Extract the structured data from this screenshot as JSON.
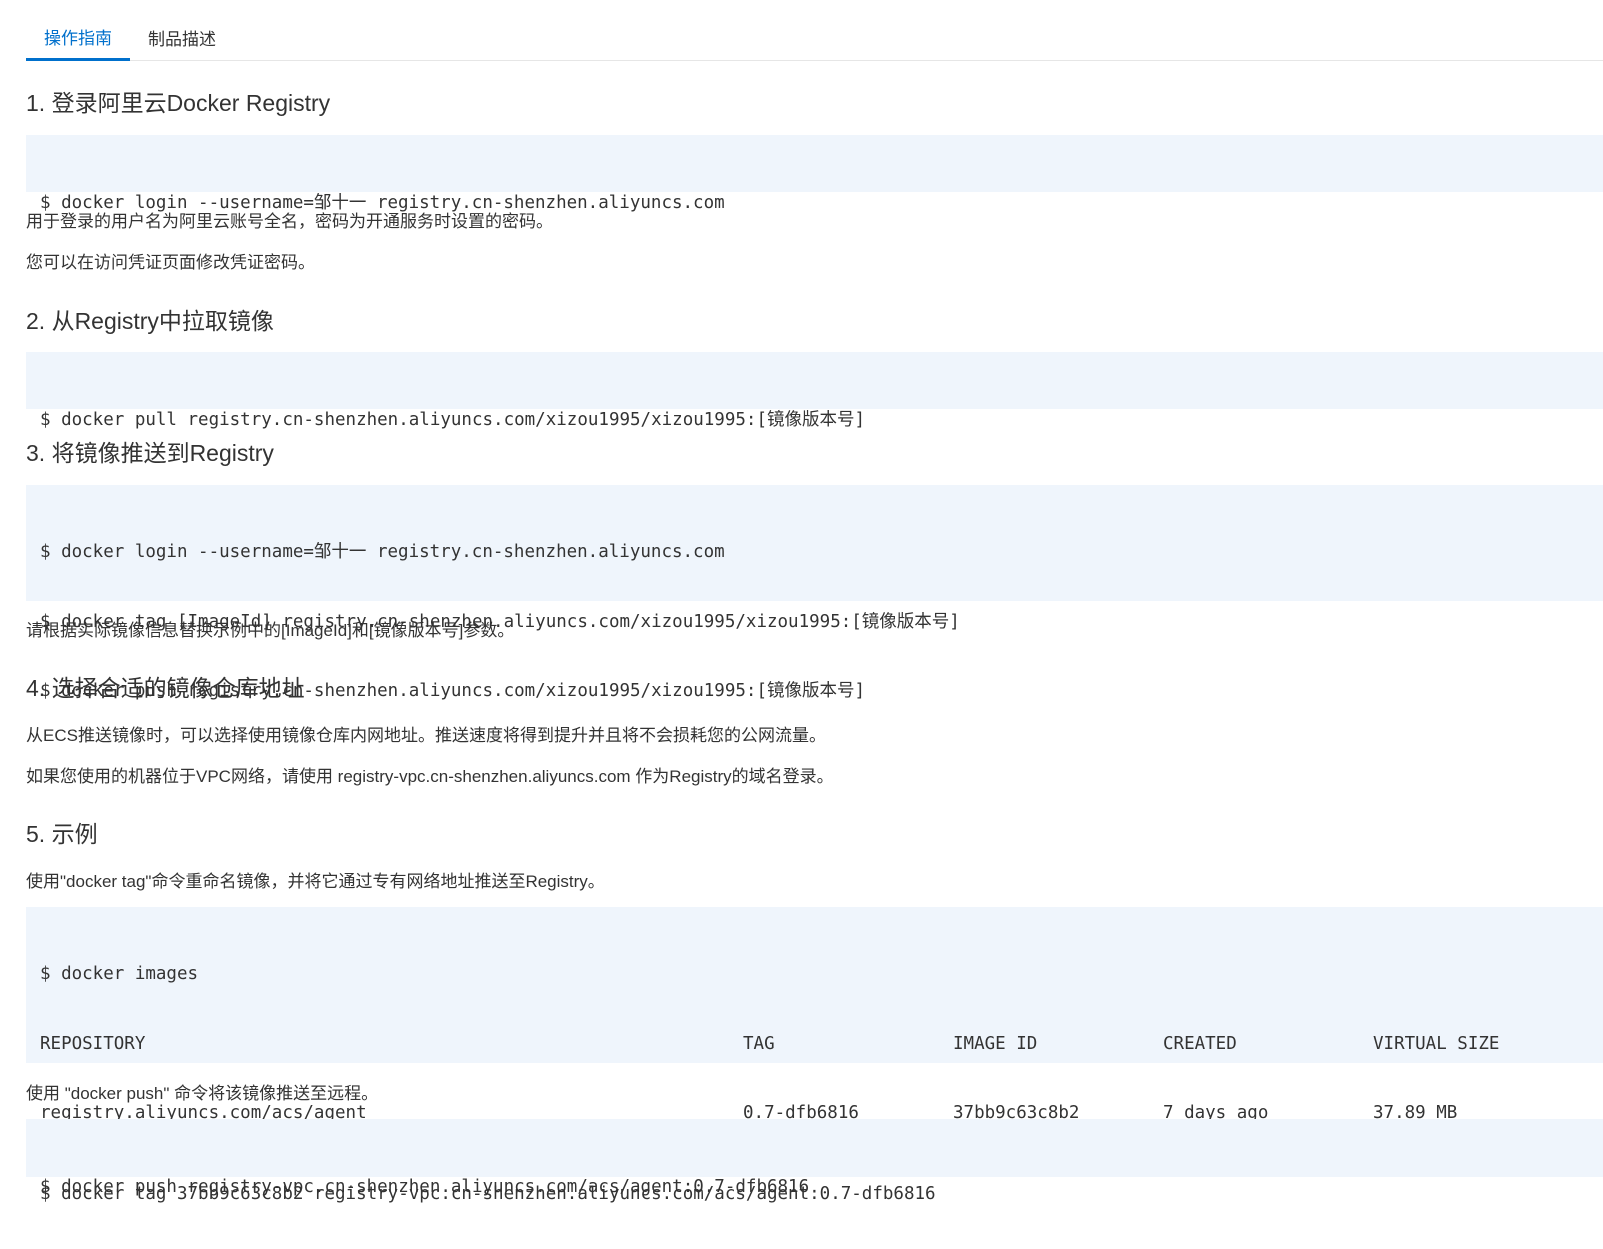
{
  "tabs": [
    {
      "label": "操作指南",
      "active": true
    },
    {
      "label": "制品描述",
      "active": false
    }
  ],
  "sections": {
    "s1": {
      "heading": "1. 登录阿里云Docker Registry",
      "code": [
        "$ docker login --username=邹十一 registry.cn-shenzhen.aliyuncs.com"
      ],
      "notes": [
        "用于登录的用户名为阿里云账号全名，密码为开通服务时设置的密码。",
        "您可以在访问凭证页面修改凭证密码。"
      ]
    },
    "s2": {
      "heading": "2. 从Registry中拉取镜像",
      "code": [
        "$ docker pull registry.cn-shenzhen.aliyuncs.com/xizou1995/xizou1995:[镜像版本号]"
      ]
    },
    "s3": {
      "heading": "3. 将镜像推送到Registry",
      "code": [
        "$ docker login --username=邹十一 registry.cn-shenzhen.aliyuncs.com",
        "$ docker tag [ImageId] registry.cn-shenzhen.aliyuncs.com/xizou1995/xizou1995:[镜像版本号]",
        "$ docker push registry.cn-shenzhen.aliyuncs.com/xizou1995/xizou1995:[镜像版本号]"
      ],
      "notes": [
        "请根据实际镜像信息替换示例中的[ImageId]和[镜像版本号]参数。"
      ]
    },
    "s4": {
      "heading": "4. 选择合适的镜像仓库地址",
      "notes": [
        "从ECS推送镜像时，可以选择使用镜像仓库内网地址。推送速度将得到提升并且将不会损耗您的公网流量。",
        "如果您使用的机器位于VPC网络，请使用 registry-vpc.cn-shenzhen.aliyuncs.com 作为Registry的域名登录。"
      ]
    },
    "s5": {
      "heading": "5. 示例",
      "intro": "使用\"docker tag\"命令重命名镜像，并将它通过专有网络地址推送至Registry。",
      "images_cmd": "$ docker images",
      "table_headers": [
        "REPOSITORY",
        "TAG",
        "IMAGE ID",
        "CREATED",
        "VIRTUAL SIZE"
      ],
      "table_row": [
        "registry.aliyuncs.com/acs/agent",
        "0.7-dfb6816",
        "37bb9c63c8b2",
        "7 days ago",
        "37.89 MB"
      ],
      "tag_cmd": "$ docker tag 37bb9c63c8b2 registry-vpc.cn-shenzhen.aliyuncs.com/acs/agent:0.7-dfb6816",
      "push_intro": "使用 \"docker push\" 命令将该镜像推送至远程。",
      "push_cmd": "$ docker push registry-vpc.cn-shenzhen.aliyuncs.com/acs/agent:0.7-dfb6816"
    }
  }
}
